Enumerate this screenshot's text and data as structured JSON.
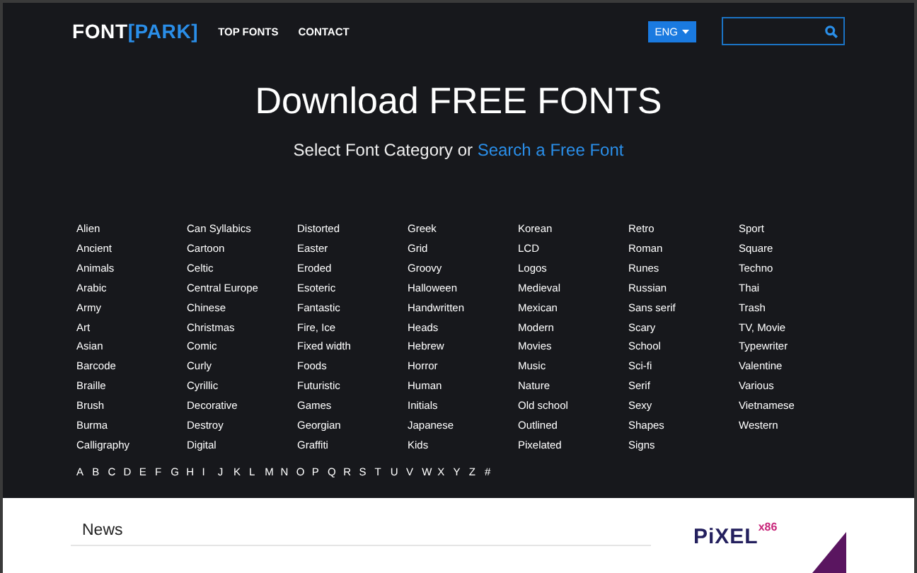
{
  "header": {
    "logo": {
      "text": "FONT",
      "accent": "[PARK]"
    },
    "nav": [
      "TOP FONTS",
      "CONTACT"
    ],
    "language": "ENG"
  },
  "hero": {
    "title": "Download FREE FONTS",
    "subtitle": "Select Font Category or ",
    "subtitle_link": "Search a Free Font"
  },
  "category_columns": [
    [
      "Alien",
      "Ancient",
      "Animals",
      "Arabic",
      "Army",
      "Art",
      "Asian",
      "Barcode",
      "Braille",
      "Brush",
      "Burma",
      "Calligraphy"
    ],
    [
      "Can Syllabics",
      "Cartoon",
      "Celtic",
      "Central Europe",
      "Chinese",
      "Christmas",
      "Comic",
      "Curly",
      "Cyrillic",
      "Decorative",
      "Destroy",
      "Digital"
    ],
    [
      "Distorted",
      "Easter",
      "Eroded",
      "Esoteric",
      "Fantastic",
      "Fire, Ice",
      "Fixed width",
      "Foods",
      "Futuristic",
      "Games",
      "Georgian",
      "Graffiti"
    ],
    [
      "Greek",
      "Grid",
      "Groovy",
      "Halloween",
      "Handwritten",
      "Heads",
      "Hebrew",
      "Horror",
      "Human",
      "Initials",
      "Japanese",
      "Kids"
    ],
    [
      "Korean",
      "LCD",
      "Logos",
      "Medieval",
      "Mexican",
      "Modern",
      "Movies",
      "Music",
      "Nature",
      "Old school",
      "Outlined",
      "Pixelated"
    ],
    [
      "Retro",
      "Roman",
      "Runes",
      "Russian",
      "Sans serif",
      "Scary",
      "School",
      "Sci-fi",
      "Serif",
      "Sexy",
      "Shapes",
      "Signs"
    ],
    [
      "Sport",
      "Square",
      "Techno",
      "Thai",
      "Trash",
      "TV, Movie",
      "Typewriter",
      "Valentine",
      "Various",
      "Vietnamese",
      "Western"
    ]
  ],
  "letters": [
    "A",
    "B",
    "C",
    "D",
    "E",
    "F",
    "G",
    "H",
    "I",
    "J",
    "K",
    "L",
    "M",
    "N",
    "O",
    "P",
    "Q",
    "R",
    "S",
    "T",
    "U",
    "V",
    "W",
    "X",
    "Y",
    "Z",
    "#"
  ],
  "news": {
    "title": "News"
  },
  "ad": {
    "brand": "PiXEL",
    "suffix": "x86"
  }
}
